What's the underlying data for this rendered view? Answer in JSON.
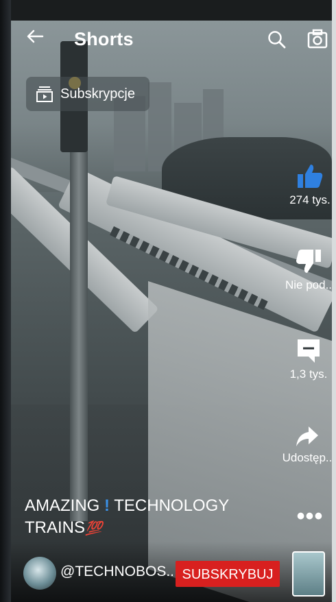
{
  "header": {
    "back_icon": "arrow-left-icon",
    "title": "Shorts",
    "search_icon": "search-icon",
    "camera_icon": "camera-icon"
  },
  "subscriptions_chip": {
    "icon": "subscriptions-icon",
    "label": "Subskrypcje"
  },
  "actions": {
    "like": {
      "icon": "thumbs-up-icon",
      "label": "274 tys.",
      "color": "#2f80e0"
    },
    "dislike": {
      "icon": "thumbs-down-icon",
      "label": "Nie pod.."
    },
    "comments": {
      "icon": "comment-icon",
      "label": "1,3 tys."
    },
    "share": {
      "icon": "share-icon",
      "label": "Udostęp.."
    },
    "more": {
      "icon": "more-dots-icon",
      "label": "•••"
    }
  },
  "video": {
    "caption_part1": "AMAZING",
    "caption_exclaim": "!",
    "caption_part2": "TECHNOLOGY",
    "caption_line2": "TRAINS",
    "caption_emoji": "💯"
  },
  "channel": {
    "handle": "@TECHNOBOS..",
    "subscribe_label": "SUBSKRYBUJ",
    "subscribe_color": "#d8201f"
  }
}
